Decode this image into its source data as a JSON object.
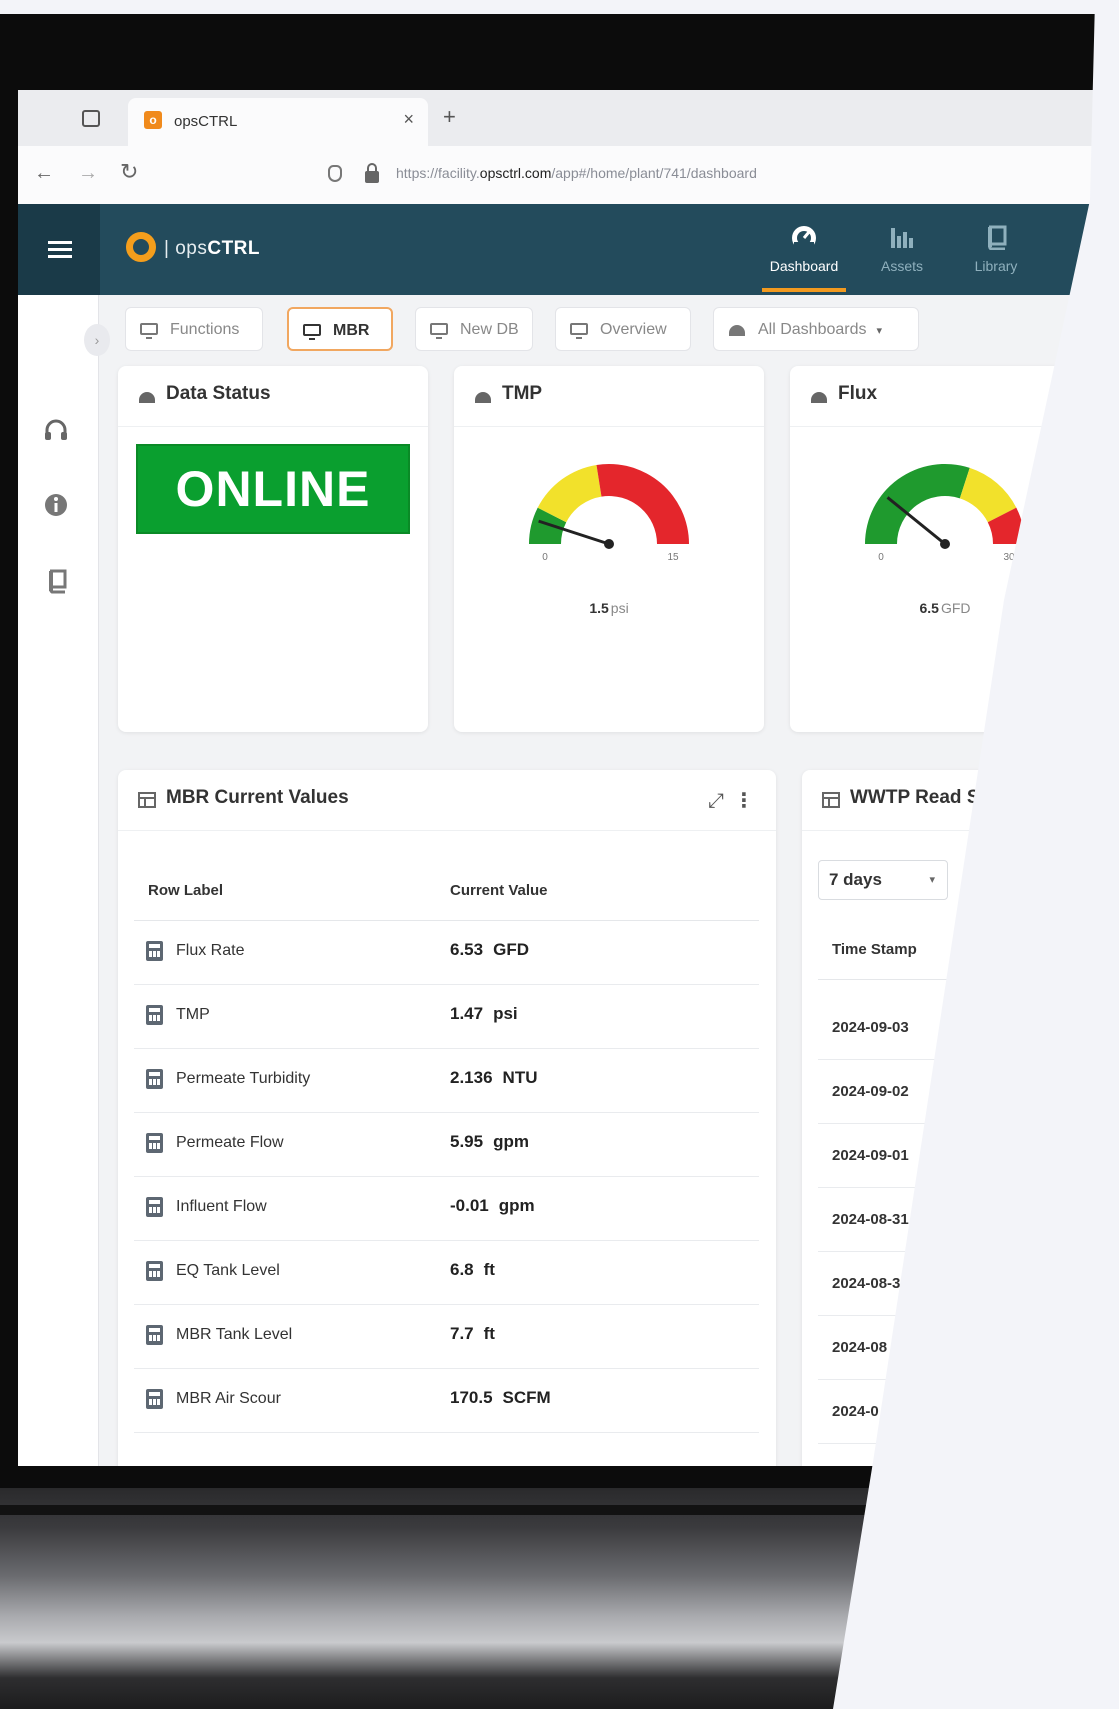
{
  "browser": {
    "tab_title": "opsCTRL",
    "tab_close": "×",
    "new_tab": "+",
    "back": "←",
    "forward": "→",
    "reload": "↻",
    "url_prefix": "https://facility.",
    "url_domain": "opsctrl.com",
    "url_path": "/app#/home/plant/741/dashboard"
  },
  "header": {
    "logo_prefix": "ops",
    "logo_bold": "CTRL",
    "nav": [
      {
        "label": "Dashboard",
        "icon": "gauge-icon",
        "active": true
      },
      {
        "label": "Assets",
        "icon": "bar-chart-icon",
        "active": false
      },
      {
        "label": "Library",
        "icon": "book-icon",
        "active": false
      }
    ],
    "accent": "#f29a1f",
    "bg": "#234b5c"
  },
  "sidebar": {
    "collapse": "›",
    "icons": [
      "headset-icon",
      "info-icon",
      "book-icon"
    ]
  },
  "toolbar": {
    "chips": [
      {
        "label": "Functions"
      },
      {
        "label": "MBR",
        "active": true
      },
      {
        "label": "New DB"
      },
      {
        "label": "Overview"
      }
    ],
    "all_dashboards": "All Dashboards",
    "caret": "▾"
  },
  "cards": {
    "data_status": {
      "title": "Data Status",
      "status": "ONLINE",
      "status_color": "#0a9f2f"
    },
    "tmp": {
      "title": "TMP",
      "value": "1.5",
      "unit": "psi",
      "min": "0",
      "max": "15",
      "reading": 1.5,
      "bands": [
        {
          "to": 0.15,
          "color": "#1f9a2e"
        },
        {
          "to": 0.45,
          "color": "#f2e12b"
        },
        {
          "to": 1.0,
          "color": "#e4262c"
        }
      ]
    },
    "flux": {
      "title": "Flux",
      "value": "6.5",
      "unit": "GFD",
      "min": "0",
      "max": "30",
      "reading": 6.5,
      "bands": [
        {
          "to": 0.6,
          "color": "#1f9a2e"
        },
        {
          "to": 0.85,
          "color": "#f2e12b"
        },
        {
          "to": 1.0,
          "color": "#e4262c"
        }
      ]
    },
    "mbr_values": {
      "title": "MBR Current Values",
      "col_label": "Row Label",
      "col_value": "Current Value",
      "expand": "⤢",
      "kebab": "⋮",
      "rows": [
        {
          "label": "Flux Rate",
          "value": "6.53",
          "unit": "GFD"
        },
        {
          "label": "TMP",
          "value": "1.47",
          "unit": "psi"
        },
        {
          "label": "Permeate Turbidity",
          "value": "2.136",
          "unit": "NTU"
        },
        {
          "label": "Permeate Flow",
          "value": "5.95",
          "unit": "gpm"
        },
        {
          "label": "Influent Flow",
          "value": "-0.01",
          "unit": "gpm"
        },
        {
          "label": "EQ Tank Level",
          "value": "6.8",
          "unit": "ft"
        },
        {
          "label": "MBR Tank Level",
          "value": "7.7",
          "unit": "ft"
        },
        {
          "label": "MBR Air Scour",
          "value": "170.5",
          "unit": "SCFM"
        }
      ]
    },
    "wwtp": {
      "title": "WWTP Read She",
      "range": "7 days",
      "col_timestamp": "Time Stamp",
      "rows": [
        "2024-09-03",
        "2024-09-02",
        "2024-09-01",
        "2024-08-31",
        "2024-08-3",
        "2024-08",
        "2024-0"
      ]
    }
  }
}
